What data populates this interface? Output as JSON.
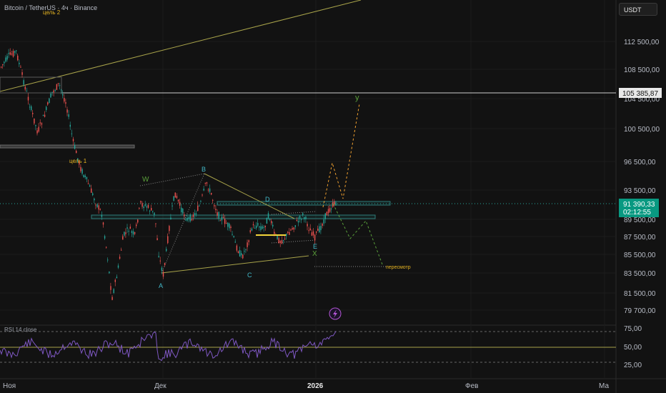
{
  "header": {
    "title": "Bitcoin / TetherUS · 4ч · Binance",
    "currency": "USDT"
  },
  "chart_data": {
    "type": "candlestick",
    "price_axis": [
      "112 500,00",
      "108 500,00",
      "104 500,00",
      "100 500,00",
      "96 500,00",
      "93 500,00",
      "89 500,00",
      "87 500,00",
      "85 500,00",
      "83 500,00",
      "81 500,00",
      "79 700,00"
    ],
    "time_axis": [
      "Ноя",
      "Дек",
      "2026",
      "Фев",
      "Ма"
    ],
    "level_label": "105 385,87",
    "current_price": "91 390,33",
    "countdown": "02:12:55",
    "wave_labels": {
      "w": "W",
      "a": "A",
      "b": "B",
      "c": "C",
      "d": "D",
      "e": "E",
      "x": "X",
      "y": "y"
    },
    "annotations": {
      "target1": "цель 1",
      "target2": "цель 2",
      "review": "пересмотр"
    },
    "rsi": {
      "label": "RSI 14 close",
      "ticks": [
        "75,00",
        "50,00",
        "25,00"
      ]
    },
    "colors": {
      "up": "#26a69a",
      "down": "#ef5350",
      "level": "#cfcfcf",
      "price_tag": "#089981",
      "rsi": "#7e57c2",
      "forecast": "#f0a030"
    }
  }
}
